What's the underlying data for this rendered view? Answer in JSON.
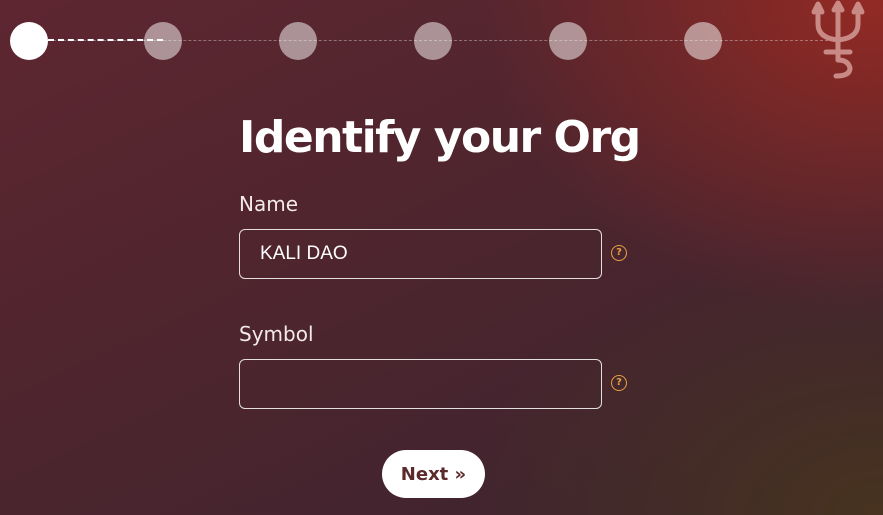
{
  "stepper": {
    "total_steps": 6,
    "current_step": 1
  },
  "logo": {
    "icon": "trident-icon",
    "color": "#c98a86"
  },
  "form": {
    "title": "Identify your Org",
    "name": {
      "label": "Name",
      "value": "KALI DAO",
      "placeholder": ""
    },
    "symbol": {
      "label": "Symbol",
      "value": "",
      "placeholder": ""
    },
    "help_glyph": "?",
    "next_label": "Next »"
  },
  "colors": {
    "accent": "#e8a046",
    "button_text": "#5b2a2a"
  }
}
